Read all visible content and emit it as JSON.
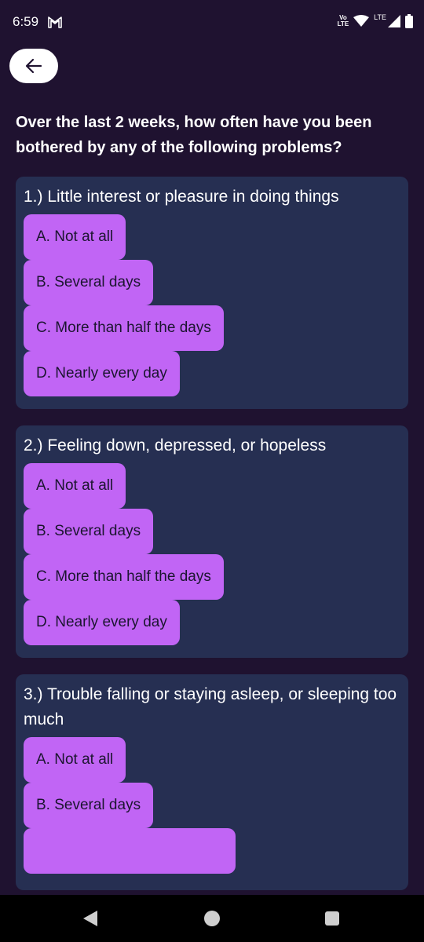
{
  "status_bar": {
    "time": "6:59",
    "volte_top": "Vo",
    "volte_bottom": "LTE",
    "lte_label": "LTE",
    "icons": [
      "gmail-icon",
      "volte-icon",
      "wifi-icon",
      "signal-icon",
      "battery-icon"
    ]
  },
  "header": {
    "back_icon": "arrow-left-icon"
  },
  "prompt": "Over the last 2 weeks, how often have you been bothered by any of the following problems?",
  "questions": [
    {
      "text": "1.) Little interest or pleasure in doing things",
      "options": [
        "A. Not at all",
        "B. Several days",
        "C. More than half the days",
        "D. Nearly every day"
      ]
    },
    {
      "text": "2.) Feeling down, depressed, or hopeless",
      "options": [
        "A. Not at all",
        "B. Several days",
        "C. More than half the days",
        "D. Nearly every day"
      ]
    },
    {
      "text": "3.) Trouble falling or staying asleep, or sleeping too much",
      "options": [
        "A. Not at all",
        "B. Several days"
      ]
    }
  ],
  "nav_bar": {
    "icons": [
      "nav-back-icon",
      "nav-home-icon",
      "nav-recents-icon"
    ]
  },
  "colors": {
    "background": "#1f1230",
    "card": "#262f52",
    "option": "#c165f5",
    "option_text": "#1c1530"
  }
}
